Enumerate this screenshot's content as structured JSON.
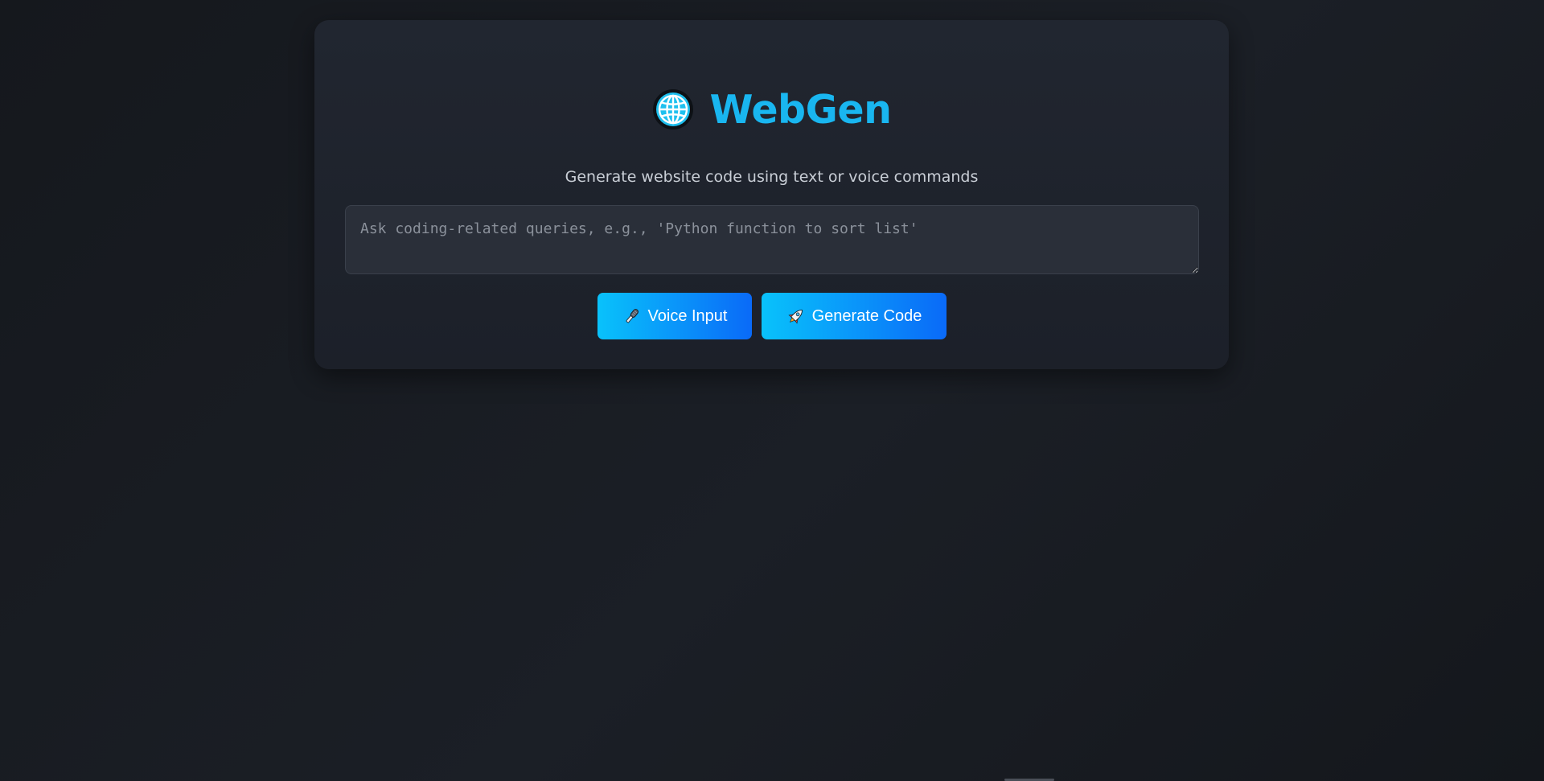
{
  "app": {
    "title": "WebGen",
    "subtitle": "Generate website code using text or voice commands",
    "logo_icon": "globe-icon"
  },
  "prompt": {
    "value": "",
    "placeholder": "Ask coding-related queries, e.g., 'Python function to sort list'"
  },
  "actions": {
    "voice_label": "Voice Input",
    "voice_icon": "microphone-icon",
    "generate_label": "Generate Code",
    "generate_icon": "rocket-icon"
  },
  "colors": {
    "accent": "#19b6f0",
    "button_gradient_start": "#09c2fb",
    "button_gradient_end": "#0a6af8",
    "card_background": "#212630",
    "page_background": "#16191e"
  }
}
